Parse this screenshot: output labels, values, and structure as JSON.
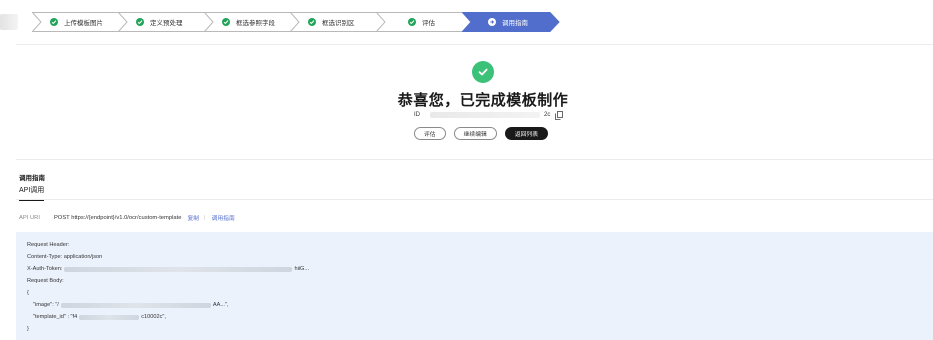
{
  "stepper": {
    "steps": [
      {
        "label": "上传模板图片",
        "status": "done"
      },
      {
        "label": "定义预处理",
        "status": "done"
      },
      {
        "label": "框选参照字段",
        "status": "done"
      },
      {
        "label": "框选识别区",
        "status": "done"
      },
      {
        "label": "评估",
        "status": "done"
      },
      {
        "label": "调用指南",
        "status": "active"
      }
    ],
    "done_color": "#22a35a",
    "active_color": "#526ecc"
  },
  "success": {
    "title": "恭喜您，已完成模板制作",
    "id_label": "ID",
    "id_suffix": "2c",
    "buttons": {
      "evaluate": "评估",
      "continue_edit": "继续编辑",
      "back_to_list": "返回列表"
    },
    "icon_color": "#3cc178"
  },
  "guide": {
    "title": "调用指南",
    "tab_api": "API调用",
    "uri_label": "API URI",
    "uri_value": "POST https://{endpoint}/v1.0/ocr/custom-template",
    "copy_link": "复制",
    "separator": "|",
    "guide_link": "调用指南",
    "code": {
      "request_header": "Request Header:",
      "content_type": "Content-Type: application/json",
      "auth_prefix": "X-Auth-Token:",
      "auth_suffix": "hiiG...",
      "request_body": "Request Body:",
      "open_brace": "{",
      "image_prefix": "\"image\": \"/",
      "image_suffix": "AA...\",",
      "template_prefix": "\"template_id\" : \"f4",
      "template_suffix": "c10002c\",",
      "close_brace": "}"
    },
    "link_color": "#526ecc",
    "code_bg": "#ecf2fc"
  }
}
